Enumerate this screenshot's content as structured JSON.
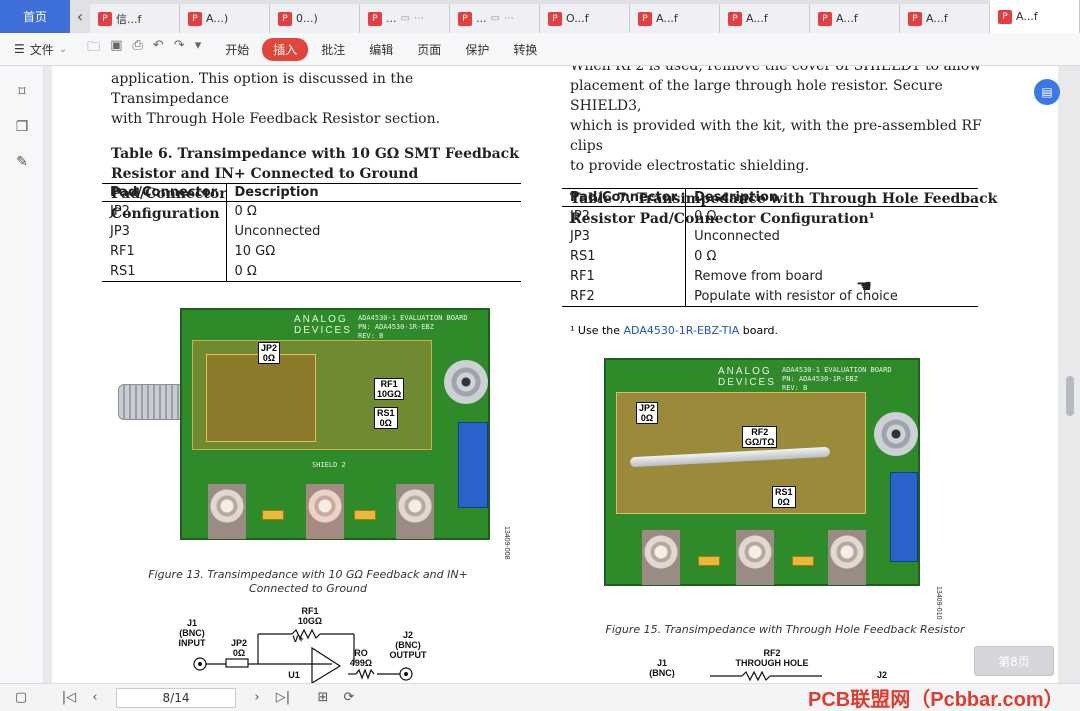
{
  "tabs": {
    "home": "首页",
    "items": [
      {
        "label": "信...f",
        "active": false
      },
      {
        "label": "A...)",
        "active": false
      },
      {
        "label": "0...)",
        "active": false
      },
      {
        "label": "...",
        "active": false
      },
      {
        "label": "...",
        "active": false
      },
      {
        "label": "O...f",
        "active": false
      },
      {
        "label": "A...f",
        "active": false
      },
      {
        "label": "A...f",
        "active": false
      },
      {
        "label": "A...f",
        "active": false
      },
      {
        "label": "A...f",
        "active": false
      },
      {
        "label": "A...f",
        "active": true
      }
    ]
  },
  "toolbar": {
    "file_menu": "文件",
    "menus": [
      "开始",
      "插入",
      "批注",
      "编辑",
      "页面",
      "保护",
      "转换"
    ],
    "active_menu": "插入"
  },
  "left": {
    "intro_line1": "application. This option is discussed in the Transimpedance",
    "intro_line2": "with Through Hole Feedback Resistor section.",
    "table_title_line1": "Table 6. Transimpedance with 10 GΩ SMT Feedback",
    "table_title_line2": "Resistor and IN+ Connected to Ground Pad/Connector",
    "table_title_line3": "Configuration",
    "headers": [
      "Pad/Connector",
      "Description"
    ],
    "rows": [
      [
        "JP2",
        "0 Ω"
      ],
      [
        "JP3",
        "Unconnected"
      ],
      [
        "RF1",
        "10 GΩ"
      ],
      [
        "RS1",
        "0 Ω"
      ]
    ],
    "caption_line1": "Figure 13. Transimpedance with 10 GΩ Feedback and IN+",
    "caption_line2": "Connected to Ground",
    "fig_id": "13409-008",
    "board": {
      "logo": "ANALOG\nDEVICES",
      "title": "ADA4530-1 EVALUATION BOARD",
      "pn": "PN: ADA4530-1R-EBZ",
      "rev": "REV: B",
      "shield": "SHIELD 2",
      "callouts": [
        {
          "name": "JP2",
          "value": "0Ω"
        },
        {
          "name": "RF1",
          "value": "10GΩ"
        },
        {
          "name": "RS1",
          "value": "0Ω"
        }
      ]
    },
    "schematic": {
      "j1": "J1\n(BNC)\nINPUT",
      "jp2": "JP2\n0Ω",
      "rf1": "RF1\n10GΩ",
      "ro": "RO\n499Ω",
      "j2": "J2\n(BNC)\nOUTPUT",
      "u1": "U1",
      "vplus": "V+"
    }
  },
  "right": {
    "intro_line0": "When RF2 is used, remove the cover of SHIELD1 to allow",
    "intro_line1": "placement of the large through hole resistor. Secure SHIELD3,",
    "intro_line2": "which is provided with the kit, with the pre-assembled RF clips",
    "intro_line3": "to provide electrostatic shielding.",
    "table_title_line1": "Table 7. Transimpedance with Through Hole Feedback",
    "table_title_line2": "Resistor Pad/Connector Configuration¹",
    "headers": [
      "Pad/Connector",
      "Description"
    ],
    "rows": [
      [
        "JP2",
        "0 Ω"
      ],
      [
        "JP3",
        "Unconnected"
      ],
      [
        "RS1",
        "0 Ω"
      ],
      [
        "RF1",
        "Remove from board"
      ],
      [
        "RF2",
        "Populate with resistor of choice"
      ]
    ],
    "footnote_prefix": "¹ Use the ",
    "footnote_link": "ADA4530-1R-EBZ-TIA",
    "footnote_suffix": " board.",
    "caption": "Figure 15. Transimpedance with Through Hole Feedback Resistor",
    "fig_id": "13409-010",
    "board": {
      "logo": "ANALOG\nDEVICES",
      "title": "ADA4530-1 EVALUATION BOARD",
      "pn": "PN: ADA4530-1R-EBZ",
      "rev": "REV: B",
      "callouts": [
        {
          "name": "JP2",
          "value": "0Ω"
        },
        {
          "name": "RF2",
          "value": "GΩ/TΩ"
        },
        {
          "name": "RS1",
          "value": "0Ω"
        }
      ]
    },
    "schematic": {
      "j1": "J1\n(BNC)",
      "rf2": "RF2\nTHROUGH HOLE",
      "j2": "J2"
    }
  },
  "pager": {
    "page_input": "8/14",
    "page_button": "第8页"
  },
  "watermark": "PCB联盟网（Pcbbar.com）",
  "colors": {
    "home_tab": "#3f6fd8",
    "active_menu": "#e0463c",
    "board_green": "#2f8a2a",
    "link": "#1a55c4"
  }
}
